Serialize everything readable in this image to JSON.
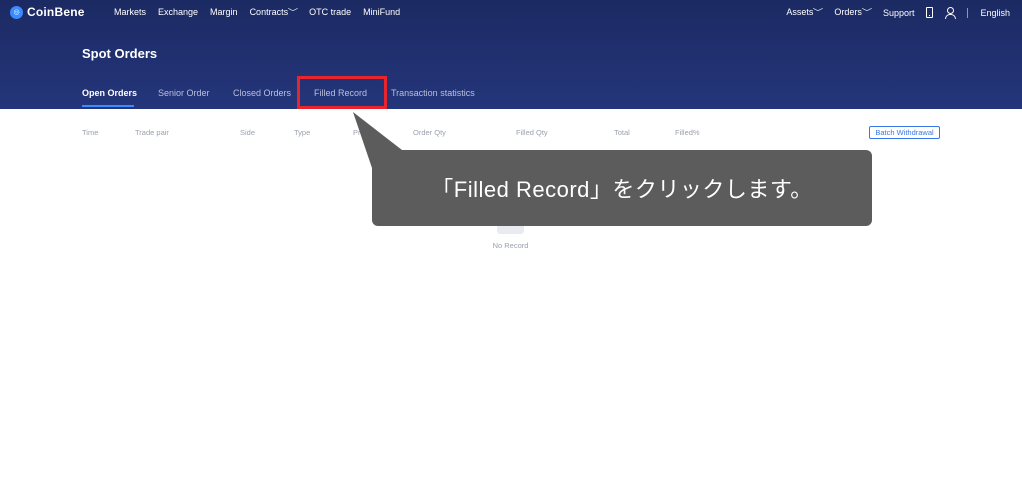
{
  "brand": {
    "logo_mark": "◎",
    "name": "CoinBene"
  },
  "topnav": {
    "left": [
      {
        "label": "Markets",
        "dropdown": false
      },
      {
        "label": "Exchange",
        "dropdown": false
      },
      {
        "label": "Margin",
        "dropdown": false
      },
      {
        "label": "Contracts",
        "dropdown": true
      },
      {
        "label": "OTC trade",
        "dropdown": false
      },
      {
        "label": "MiniFund",
        "dropdown": false
      }
    ],
    "right": {
      "assets": "Assets",
      "orders": "Orders",
      "support": "Support",
      "language": "English"
    }
  },
  "page": {
    "title": "Spot Orders"
  },
  "tabs": [
    {
      "label": "Open Orders",
      "active": true
    },
    {
      "label": "Senior Order",
      "active": false
    },
    {
      "label": "Closed Orders",
      "active": false
    },
    {
      "label": "Filled Record",
      "active": false,
      "highlighted": true
    },
    {
      "label": "Transaction statistics",
      "active": false
    }
  ],
  "table": {
    "columns": [
      "Time",
      "Trade pair",
      "Side",
      "Type",
      "Price",
      "Order Qty",
      "Filled Qty",
      "Total",
      "Filled%"
    ],
    "batch_button": "Batch Withdrawal",
    "empty_text": "No Record"
  },
  "annotation": {
    "text": "「Filled Record」をクリックします。",
    "highlight_color": "#e8242c",
    "bubble_color": "#5c5c5c"
  },
  "colors": {
    "header_bg": "#1c2a63",
    "accent": "#3b8bff"
  }
}
